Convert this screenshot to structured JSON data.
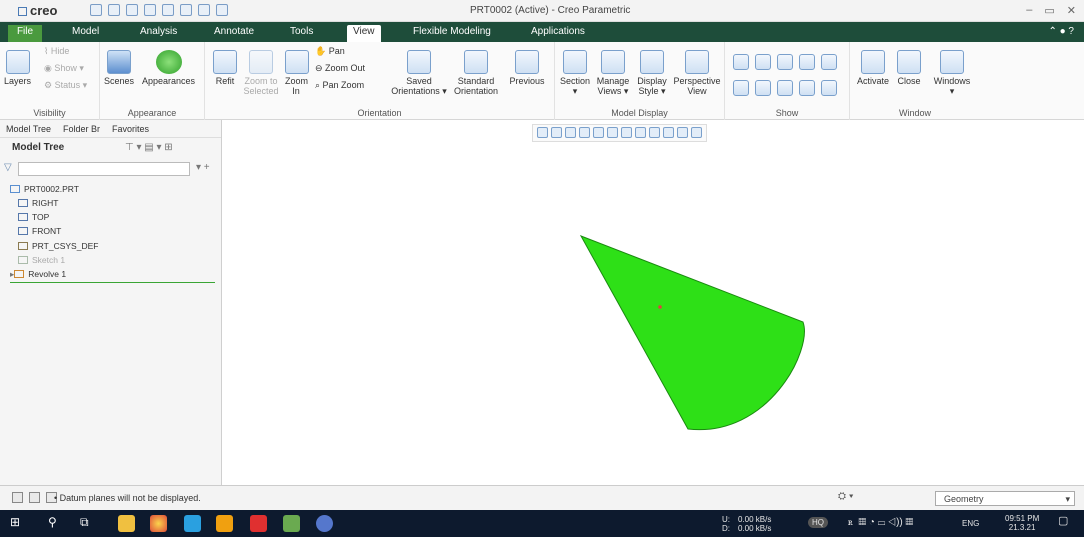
{
  "window": {
    "app_name": "creo",
    "title": "PRT0002 (Active) - Creo Parametric"
  },
  "tabs": [
    "File",
    "Model",
    "Analysis",
    "Annotate",
    "Tools",
    "View",
    "Flexible Modeling",
    "Applications"
  ],
  "active_tab": "View",
  "ribbon": {
    "visibility": {
      "layers": "Layers",
      "hide": "Hide",
      "show": "Show",
      "status": "Status",
      "label": "Visibility"
    },
    "appearance": {
      "scenes": "Scenes",
      "appearances": "Appearances",
      "label": "Appearance"
    },
    "orientation": {
      "refit": "Refit",
      "zoom_selected": "Zoom to Selected",
      "zoom_in": "Zoom In",
      "pan": "Pan",
      "zoom_out": "Zoom Out",
      "pan_zoom": "Pan Zoom",
      "saved": "Saved Orientations",
      "standard": "Standard Orientation",
      "previous": "Previous",
      "label": "Orientation"
    },
    "model_display": {
      "section": "Section",
      "manage_views": "Manage Views",
      "display_style": "Display Style",
      "perspective": "Perspective View",
      "label": "Model Display"
    },
    "show": {
      "label": "Show"
    },
    "window": {
      "activate": "Activate",
      "close": "Close",
      "windows": "Windows",
      "label": "Window"
    }
  },
  "sidebar": {
    "tabs": [
      "Model Tree",
      "Folder Br",
      "Favorites"
    ],
    "heading": "Model Tree",
    "tree": [
      {
        "label": "PRT0002.PRT",
        "indent": 0
      },
      {
        "label": "RIGHT",
        "indent": 1
      },
      {
        "label": "TOP",
        "indent": 1
      },
      {
        "label": "FRONT",
        "indent": 1
      },
      {
        "label": "PRT_CSYS_DEF",
        "indent": 1
      },
      {
        "label": "Sketch 1",
        "indent": 1,
        "dim": true
      },
      {
        "label": "Revolve 1",
        "indent": 0
      }
    ]
  },
  "status": {
    "message": "Datum planes will not be displayed.",
    "filter": "Geometry"
  },
  "taskbar": {
    "net_up_label": "U:",
    "net_down_label": "D:",
    "net_up": "0.00 kB/s",
    "net_down": "0.00 kB/s",
    "hq": "HQ",
    "lang": "ENG",
    "time": "09:51 PM",
    "date": "21.3.21"
  },
  "colors": {
    "cone": "#2ee017",
    "ribbon_tab_bar": "#1e4d3a",
    "file_tab": "#4a9a3e"
  }
}
